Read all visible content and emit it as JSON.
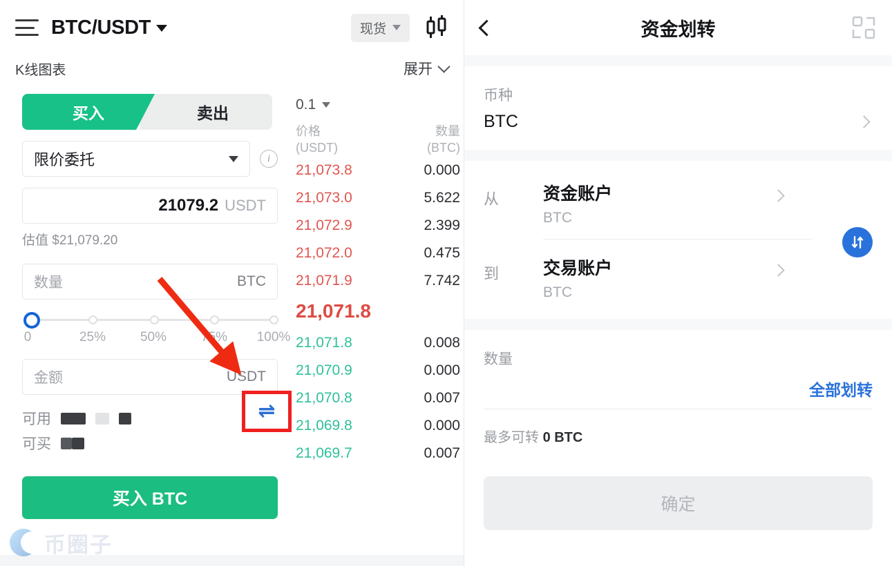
{
  "left": {
    "header": {
      "menu_icon": "hamburger-icon",
      "pair": "BTC/USDT",
      "pair_caret": "caret-down-icon",
      "market_type": "现货",
      "market_caret": "caret-down-icon",
      "chart_icon": "candlestick-icon"
    },
    "kline": {
      "label": "K线图表",
      "expand": "展开",
      "chevron": "chevron-down-icon"
    },
    "tabs": {
      "buy": "买入",
      "sell": "卖出",
      "active": "买入"
    },
    "order_type": {
      "value": "限价委托",
      "caret": "caret-down-icon",
      "info": "info-icon"
    },
    "price": {
      "value": "21079.2",
      "unit": "USDT"
    },
    "estimate": "估值 $21,079.20",
    "quantity": {
      "placeholder": "数量",
      "unit": "BTC",
      "value": ""
    },
    "slider": {
      "value": 0,
      "ticks": [
        "0",
        "25%",
        "50%",
        "75%",
        "100%"
      ]
    },
    "amount": {
      "placeholder": "金额",
      "unit": "USDT",
      "value": ""
    },
    "balances": [
      {
        "label": "可用",
        "redacted": true
      },
      {
        "label": "可买",
        "redacted": true
      }
    ],
    "swap_toggle": {
      "icon": "swap-horizontal-icon",
      "highlighted": true
    },
    "submit": "买入 BTC",
    "watermark": "币圈子"
  },
  "orderbook": {
    "precision": "0.1",
    "precision_caret": "caret-down-icon",
    "headers": {
      "price": "价格",
      "price_unit": "(USDT)",
      "qty": "数量",
      "qty_unit": "(BTC)"
    },
    "asks": [
      {
        "price": "21,073.8",
        "qty": "0.000"
      },
      {
        "price": "21,073.0",
        "qty": "5.622"
      },
      {
        "price": "21,072.9",
        "qty": "2.399"
      },
      {
        "price": "21,072.0",
        "qty": "0.475"
      },
      {
        "price": "21,071.9",
        "qty": "7.742"
      }
    ],
    "last_price": "21,071.8",
    "bids": [
      {
        "price": "21,071.8",
        "qty": "0.008"
      },
      {
        "price": "21,070.9",
        "qty": "0.000"
      },
      {
        "price": "21,070.8",
        "qty": "0.007"
      },
      {
        "price": "21,069.8",
        "qty": "0.000"
      },
      {
        "price": "21,069.7",
        "qty": "0.007"
      }
    ],
    "colors": {
      "ask": "#e0564f",
      "bid": "#2fc09a",
      "last": "#dd4b42"
    }
  },
  "right": {
    "header": {
      "back": "back-chevron-icon",
      "title": "资金划转",
      "scan": "scan-icon"
    },
    "coin": {
      "label": "币种",
      "value": "BTC",
      "chevron": "chevron-right-icon"
    },
    "transfer": {
      "from_key": "从",
      "from_name": "资金账户",
      "from_sub": "BTC",
      "to_key": "到",
      "to_name": "交易账户",
      "to_sub": "BTC",
      "swap_icon": "swap-vertical-icon",
      "chevron": "chevron-right-icon"
    },
    "amount": {
      "label": "数量",
      "value": "",
      "all_label": "全部划转",
      "max_label": "最多可转",
      "max_value": "0 BTC"
    },
    "confirm": "确定"
  },
  "theme": {
    "green": "#1bbd80",
    "tab_green": "#17c187",
    "blue": "#2a72db",
    "red_highlight": "#ef2020",
    "ask_red": "#e0564f",
    "bid_green": "#2fc09a"
  }
}
